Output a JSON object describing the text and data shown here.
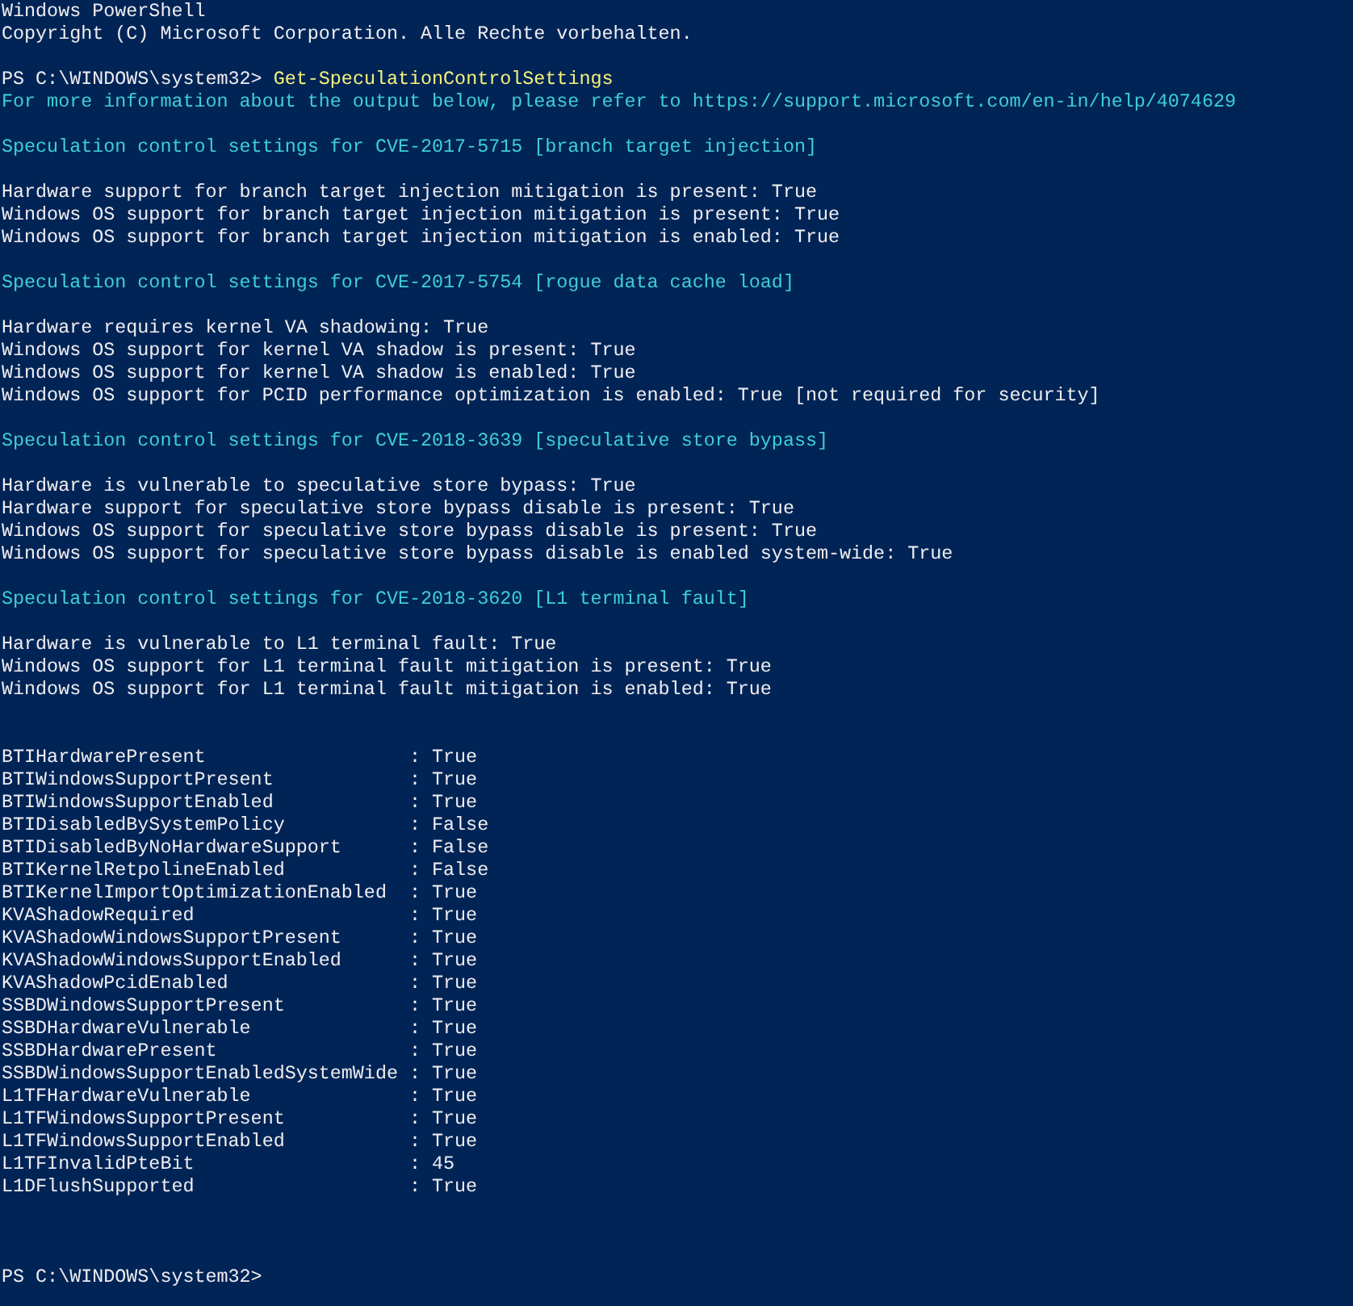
{
  "console": {
    "lines": [
      {
        "kind": "output",
        "text": "Windows PowerShell"
      },
      {
        "kind": "output",
        "text": "Copyright (C) Microsoft Corporation. Alle Rechte vorbehalten."
      },
      {
        "kind": "blank"
      },
      {
        "kind": "command",
        "prompt": "PS C:\\WINDOWS\\system32>",
        "command": "Get-SpeculationControlSettings"
      },
      {
        "kind": "info",
        "text": "For more information about the output below, please refer to https://support.microsoft.com/en-in/help/4074629"
      },
      {
        "kind": "blank"
      },
      {
        "kind": "info",
        "text": "Speculation control settings for CVE-2017-5715 [branch target injection]"
      },
      {
        "kind": "blank"
      },
      {
        "kind": "output",
        "text": "Hardware support for branch target injection mitigation is present: True"
      },
      {
        "kind": "output",
        "text": "Windows OS support for branch target injection mitigation is present: True"
      },
      {
        "kind": "output",
        "text": "Windows OS support for branch target injection mitigation is enabled: True"
      },
      {
        "kind": "blank"
      },
      {
        "kind": "info",
        "text": "Speculation control settings for CVE-2017-5754 [rogue data cache load]"
      },
      {
        "kind": "blank"
      },
      {
        "kind": "output",
        "text": "Hardware requires kernel VA shadowing: True"
      },
      {
        "kind": "output",
        "text": "Windows OS support for kernel VA shadow is present: True"
      },
      {
        "kind": "output",
        "text": "Windows OS support for kernel VA shadow is enabled: True"
      },
      {
        "kind": "output",
        "text": "Windows OS support for PCID performance optimization is enabled: True [not required for security]"
      },
      {
        "kind": "blank"
      },
      {
        "kind": "info",
        "text": "Speculation control settings for CVE-2018-3639 [speculative store bypass]"
      },
      {
        "kind": "blank"
      },
      {
        "kind": "output",
        "text": "Hardware is vulnerable to speculative store bypass: True"
      },
      {
        "kind": "output",
        "text": "Hardware support for speculative store bypass disable is present: True"
      },
      {
        "kind": "output",
        "text": "Windows OS support for speculative store bypass disable is present: True"
      },
      {
        "kind": "output",
        "text": "Windows OS support for speculative store bypass disable is enabled system-wide: True"
      },
      {
        "kind": "blank"
      },
      {
        "kind": "info",
        "text": "Speculation control settings for CVE-2018-3620 [L1 terminal fault]"
      },
      {
        "kind": "blank"
      },
      {
        "kind": "output",
        "text": "Hardware is vulnerable to L1 terminal fault: True"
      },
      {
        "kind": "output",
        "text": "Windows OS support for L1 terminal fault mitigation is present: True"
      },
      {
        "kind": "output",
        "text": "Windows OS support for L1 terminal fault mitigation is enabled: True"
      },
      {
        "kind": "blank"
      },
      {
        "kind": "blank"
      },
      {
        "kind": "property",
        "name": "BTIHardwarePresent",
        "value": ": True"
      },
      {
        "kind": "property",
        "name": "BTIWindowsSupportPresent",
        "value": ": True"
      },
      {
        "kind": "property",
        "name": "BTIWindowsSupportEnabled",
        "value": ": True"
      },
      {
        "kind": "property",
        "name": "BTIDisabledBySystemPolicy",
        "value": ": False"
      },
      {
        "kind": "property",
        "name": "BTIDisabledByNoHardwareSupport",
        "value": ": False"
      },
      {
        "kind": "property",
        "name": "BTIKernelRetpolineEnabled",
        "value": ": False"
      },
      {
        "kind": "property",
        "name": "BTIKernelImportOptimizationEnabled",
        "value": ": True"
      },
      {
        "kind": "property",
        "name": "KVAShadowRequired",
        "value": ": True"
      },
      {
        "kind": "property",
        "name": "KVAShadowWindowsSupportPresent",
        "value": ": True"
      },
      {
        "kind": "property",
        "name": "KVAShadowWindowsSupportEnabled",
        "value": ": True"
      },
      {
        "kind": "property",
        "name": "KVAShadowPcidEnabled",
        "value": ": True"
      },
      {
        "kind": "property",
        "name": "SSBDWindowsSupportPresent",
        "value": ": True"
      },
      {
        "kind": "property",
        "name": "SSBDHardwareVulnerable",
        "value": ": True"
      },
      {
        "kind": "property",
        "name": "SSBDHardwarePresent",
        "value": ": True"
      },
      {
        "kind": "property",
        "name": "SSBDWindowsSupportEnabledSystemWide",
        "value": ": True"
      },
      {
        "kind": "property",
        "name": "L1TFHardwareVulnerable",
        "value": ": True"
      },
      {
        "kind": "property",
        "name": "L1TFWindowsSupportPresent",
        "value": ": True"
      },
      {
        "kind": "property",
        "name": "L1TFWindowsSupportEnabled",
        "value": ": True"
      },
      {
        "kind": "property",
        "name": "L1TFInvalidPteBit",
        "value": ": 45"
      },
      {
        "kind": "property",
        "name": "L1DFlushSupported",
        "value": ": True"
      },
      {
        "kind": "blank"
      },
      {
        "kind": "blank"
      },
      {
        "kind": "blank"
      },
      {
        "kind": "prompt",
        "prompt": "PS C:\\WINDOWS\\system32>"
      }
    ]
  }
}
